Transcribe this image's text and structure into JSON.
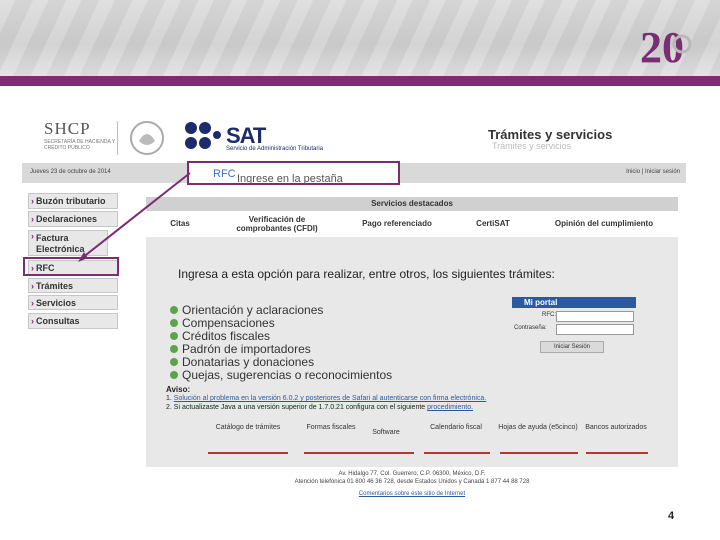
{
  "slide": {
    "logo_text": "20",
    "page_number": "4",
    "accent_color": "#7b2d73"
  },
  "screenshot": {
    "shcp": {
      "title": "SHCP",
      "subtitle": "SECRETARÍA DE HACIENDA Y CRÉDITO PÚBLICO"
    },
    "sat": {
      "name": "SAT",
      "subtitle": "Servicio de Administración Tributaria"
    },
    "tramites_title": "Trámites y servicios",
    "tramites_ghost": "Trámites y servicios",
    "date": "Jueves 23 de octubre de 2014",
    "login_link": "Inicio | Iniciar sesión",
    "callout": {
      "text": "Ingrese en la pestaña ",
      "highlight": "RFC"
    },
    "sidebar": [
      {
        "label": "Buzón tributario"
      },
      {
        "label": "Declaraciones"
      },
      {
        "label": "Factura Electrónica"
      },
      {
        "label": "RFC"
      },
      {
        "label": "Trámites"
      },
      {
        "label": "Servicios"
      },
      {
        "label": "Consultas"
      }
    ],
    "servicios_destacados": "Servicios destacados",
    "services": [
      {
        "label": "Citas"
      },
      {
        "label": "Verificación de comprobantes (CFDI)"
      },
      {
        "label": "Pago referenciado"
      },
      {
        "label": "CertiSAT"
      },
      {
        "label": "Opinión del cumplimiento"
      }
    ],
    "panel_heading": "Ingresa a esta opción para realizar, entre otros, los siguientes trámites:",
    "tramites_list": [
      "Orientación y aclaraciones",
      "Compensaciones",
      "Créditos fiscales",
      "Padrón de importadores",
      "Donatarias y donaciones",
      "Quejas, sugerencias o reconocimientos"
    ],
    "portal": {
      "title": "Mi portal",
      "rfc_label": "RFC:",
      "password_label": "Contraseña:",
      "button": "Iniciar Sesión"
    },
    "aviso": {
      "title": "Aviso:",
      "line1_num": "1.",
      "line1_link": "Solución al problema en la versión 6.0.2 y posteriores de Safari al autenticarse con firma electrónica.",
      "line2_num": "2.",
      "line2_text": "Si actualizaste Java a una versión superior de 1.7.0.21 configura con el siguiente ",
      "line2_link": "procedimiento."
    },
    "tabs": [
      {
        "label": "Catálogo de trámites"
      },
      {
        "label": "Formas fiscales"
      },
      {
        "label": "Software"
      },
      {
        "label": "Calendario fiscal"
      },
      {
        "label": "Hojas de ayuda (e5cinco)"
      },
      {
        "label": "Bancos autorizados"
      }
    ],
    "footer": {
      "address": "Av. Hidalgo 77, Col. Guerrero, C.P. 06300, México, D.F.",
      "phones": "Atención telefónica 01 800 46 36 728, desde Estados Unidos y Canadá 1 877 44 88 728",
      "comments": "Comentarios sobre este sitio de Internet"
    }
  }
}
